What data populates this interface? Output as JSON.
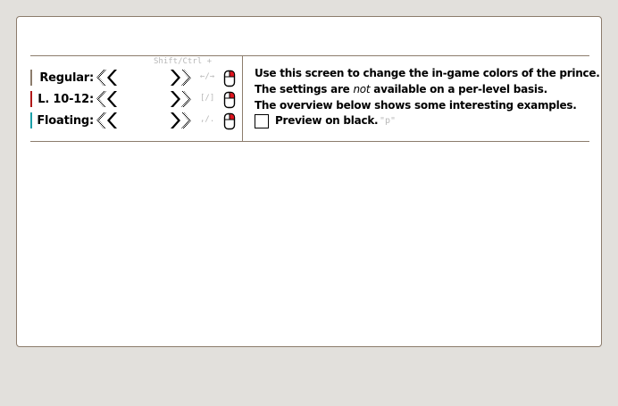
{
  "colors": {
    "background": "#e2e0dc",
    "panel": "#ffffff",
    "border": "#8c7c6c",
    "hint_text": "#b8b8b8"
  },
  "shortcut_modifier_hint": "Shift/Ctrl +",
  "color_rows": [
    {
      "label": "Regular:",
      "accent": "#8c7c6c",
      "key_hint": "←/→"
    },
    {
      "label": "L. 10-12:",
      "accent": "#b01818",
      "key_hint": "[/]"
    },
    {
      "label": "Floating:",
      "accent": "#1aa0a8",
      "key_hint": ",/."
    }
  ],
  "info": {
    "line1": "Use this screen to change the in-game colors of the prince.",
    "line2_before": "The settings are ",
    "line2_em": "not",
    "line2_after": " available on a per-level basis.",
    "line3": "The overview below shows some interesting examples."
  },
  "preview": {
    "label": "Preview on black.",
    "key_hint": "\"p\"",
    "checked": false
  },
  "icons": {
    "prev": "double-chevron-left-icon",
    "next": "double-chevron-right-icon",
    "mouse": "mouse-icon"
  }
}
